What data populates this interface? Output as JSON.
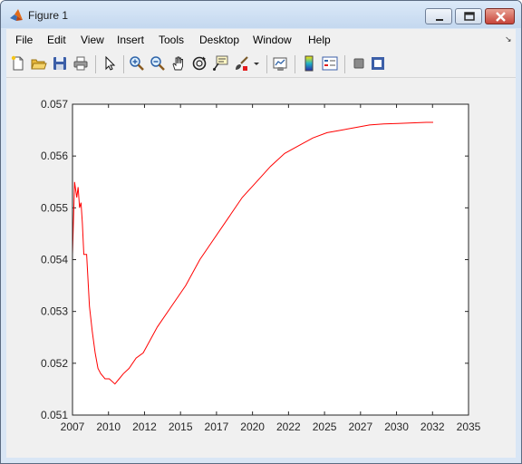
{
  "window": {
    "title": "Figure 1",
    "app_icon": "matlab-logo-icon",
    "buttons": [
      "minimize-icon",
      "maximize-icon",
      "close-icon"
    ]
  },
  "menu": {
    "items": [
      "File",
      "Edit",
      "View",
      "Insert",
      "Tools",
      "Desktop",
      "Window",
      "Help"
    ]
  },
  "toolbar": {
    "icons": [
      "new-figure-icon",
      "open-file-icon",
      "save-icon",
      "print-icon",
      "edit-plot-pointer-icon",
      "zoom-in-icon",
      "zoom-out-icon",
      "pan-hand-icon",
      "rotate-3d-icon",
      "data-cursor-icon",
      "brush-icon",
      "brush-dropdown-icon",
      "link-plot-icon",
      "colorbar-icon",
      "legend-icon",
      "hide-plot-tools-icon",
      "show-plot-tools-icon"
    ]
  },
  "chart_data": {
    "type": "line",
    "title": "",
    "xlabel": "",
    "ylabel": "",
    "xlim": [
      2007,
      2035
    ],
    "ylim": [
      0.051,
      0.057
    ],
    "xticks": [
      "2007",
      "2010",
      "2012",
      "2015",
      "2017",
      "2020",
      "2022",
      "2025",
      "2027",
      "2030",
      "2032",
      "2035"
    ],
    "yticks": [
      "0.051",
      "0.052",
      "0.053",
      "0.054",
      "0.055",
      "0.056",
      "0.057"
    ],
    "grid": false,
    "line_color": "#ff0000",
    "series": [
      {
        "x": [
          2007.0,
          2007.15,
          2007.3,
          2007.4,
          2007.5,
          2007.6,
          2007.7,
          2007.8,
          2008.0,
          2008.2,
          2008.4,
          2008.6,
          2008.8,
          2009.0,
          2009.3,
          2009.6,
          2010.0,
          2010.3,
          2010.6,
          2011.0,
          2011.5,
          2012.0,
          2013.0,
          2014.0,
          2015.0,
          2016.0,
          2017.0,
          2018.0,
          2019.0,
          2020.0,
          2021.0,
          2022.0,
          2023.0,
          2024.0,
          2025.0,
          2026.0,
          2027.0,
          2028.0,
          2029.0,
          2030.0,
          2031.0,
          2032.0,
          2032.5
        ],
        "y": [
          0.0541,
          0.0555,
          0.0552,
          0.0554,
          0.055,
          0.0551,
          0.0547,
          0.0541,
          0.0541,
          0.0531,
          0.0526,
          0.0522,
          0.0519,
          0.0518,
          0.0517,
          0.0517,
          0.0516,
          0.0517,
          0.0518,
          0.0519,
          0.0521,
          0.0522,
          0.0527,
          0.0531,
          0.0535,
          0.054,
          0.0544,
          0.0548,
          0.0552,
          0.0555,
          0.0558,
          0.05605,
          0.0562,
          0.05635,
          0.05645,
          0.0565,
          0.05655,
          0.0566,
          0.05662,
          0.05663,
          0.05664,
          0.05665,
          0.05665
        ]
      }
    ]
  }
}
